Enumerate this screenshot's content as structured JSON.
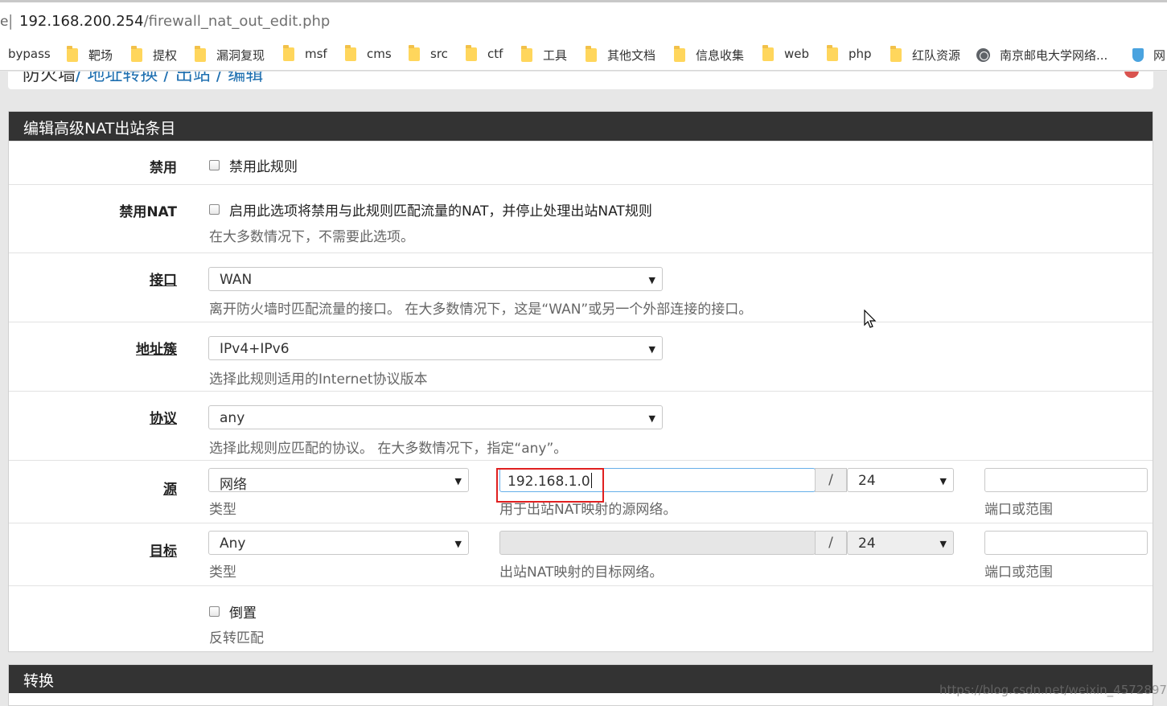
{
  "browser": {
    "url_edge": "e",
    "url_separator": "|",
    "url_host": "192.168.200.254",
    "url_path": "/firewall_nat_out_edit.php"
  },
  "bookmarks": [
    {
      "label": "bypass",
      "icon": "none"
    },
    {
      "label": "靶场",
      "icon": "folder-icon"
    },
    {
      "label": "提权",
      "icon": "folder-icon"
    },
    {
      "label": "漏洞复现",
      "icon": "folder-icon"
    },
    {
      "label": "msf",
      "icon": "folder-icon"
    },
    {
      "label": "cms",
      "icon": "folder-icon"
    },
    {
      "label": "src",
      "icon": "folder-icon"
    },
    {
      "label": "ctf",
      "icon": "folder-icon"
    },
    {
      "label": "工具",
      "icon": "folder-icon"
    },
    {
      "label": "其他文档",
      "icon": "folder-icon"
    },
    {
      "label": "信息收集",
      "icon": "folder-icon"
    },
    {
      "label": "web",
      "icon": "folder-icon"
    },
    {
      "label": "php",
      "icon": "folder-icon"
    },
    {
      "label": "红队资源",
      "icon": "folder-icon"
    },
    {
      "label": "南京邮电大学网络...",
      "icon": "globe-icon"
    },
    {
      "label": "网",
      "icon": "shield-icon"
    }
  ],
  "breadcrumb": {
    "first": "防火墙",
    "rest": "/ 地址转换 / 出站 / 编辑"
  },
  "panel": {
    "title": "编辑高级NAT出站条目",
    "disabled": {
      "label": "禁用",
      "checkbox_text": "禁用此规则"
    },
    "nonat": {
      "label": "禁用NAT",
      "checkbox_text": "启用此选项将禁用与此规则匹配流量的NAT，并停止处理出站NAT规则",
      "hint": "在大多数情况下，不需要此选项。"
    },
    "interface": {
      "label": "接口",
      "value": "WAN",
      "hint": "离开防火墙时匹配流量的接口。 在大多数情况下，这是“WAN”或另一个外部连接的接口。"
    },
    "address_family": {
      "label": "地址簇",
      "value": "IPv4+IPv6",
      "hint": "选择此规则适用的Internet协议版本"
    },
    "protocol": {
      "label": "协议",
      "value": "any",
      "hint": "选择此规则应匹配的协议。 在大多数情况下，指定“any”。"
    },
    "source": {
      "label": "源",
      "type_value": "网络",
      "type_hint": "类型",
      "address_value": "192.168.1.0",
      "address_hint": "用于出站NAT映射的源网络。",
      "slash": "/",
      "mask_value": "24",
      "port_value": "",
      "port_hint": "端口或范围"
    },
    "destination": {
      "label": "目标",
      "type_value": "Any",
      "type_hint": "类型",
      "address_value": "",
      "address_hint": "出站NAT映射的目标网络。",
      "slash": "/",
      "mask_value": "24",
      "port_value": "",
      "port_hint": "端口或范围"
    },
    "invert": {
      "checkbox_text": "倒置",
      "hint": "反转匹配"
    }
  },
  "panel2": {
    "title": "转换"
  },
  "watermark": "https://blog.csdn.net/weixin_4572897",
  "colors": {
    "header_bg": "#333333",
    "link_blue": "#1e6fb0",
    "highlight_red": "#e02020"
  }
}
